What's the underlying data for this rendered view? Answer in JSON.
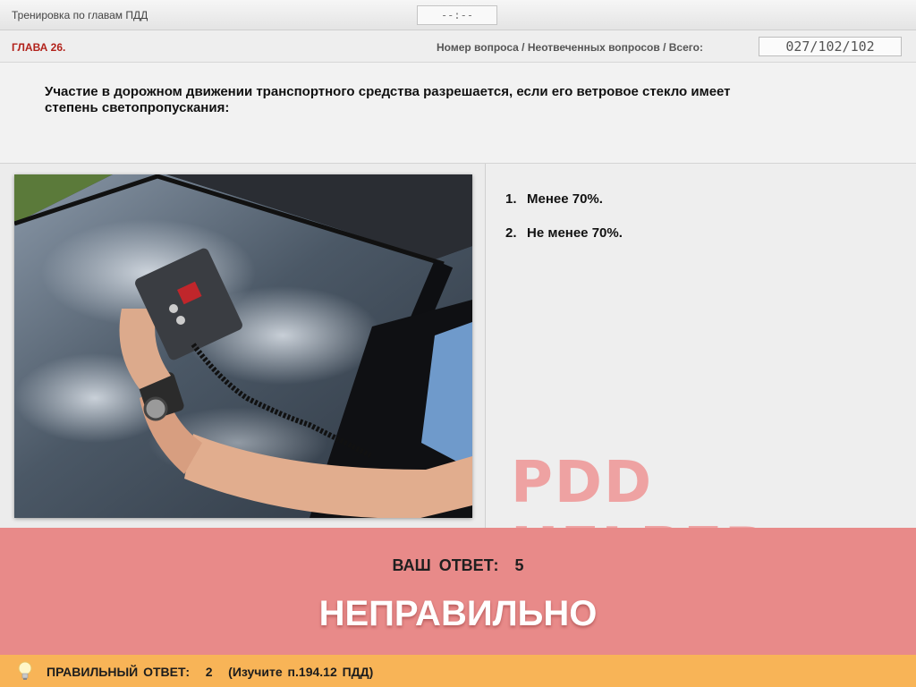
{
  "header": {
    "title": "Тренировка по главам ПДД",
    "timer": "--:--"
  },
  "chapter": {
    "label": "ГЛАВА 26.",
    "counter_label": "Номер вопроса / Неотвеченных вопросов / Всего:",
    "counter_value": "027/102/102"
  },
  "question": {
    "text": "Участие в дорожном движении транспортного средства разрешается, если его ветровое стекло имеет степень светопропускания:"
  },
  "answers": [
    {
      "number": "1.",
      "text": "Менее 70%."
    },
    {
      "number": "2.",
      "text": "Не менее 70%."
    }
  ],
  "watermark": "PDD HELPER",
  "result": {
    "your_answer_label": "ВАШ ОТВЕТ:",
    "your_answer_value": "5",
    "verdict": "НЕПРАВИЛЬНО"
  },
  "correct": {
    "label": "ПРАВИЛЬНЫЙ ОТВЕТ:",
    "value": "2",
    "hint": "(Изучите п.194.12 ПДД)"
  },
  "colors": {
    "chapter_red": "#b2221b",
    "result_bg": "#e88a89",
    "correct_bg": "#f8b457",
    "watermark": "#ee9a9a"
  }
}
